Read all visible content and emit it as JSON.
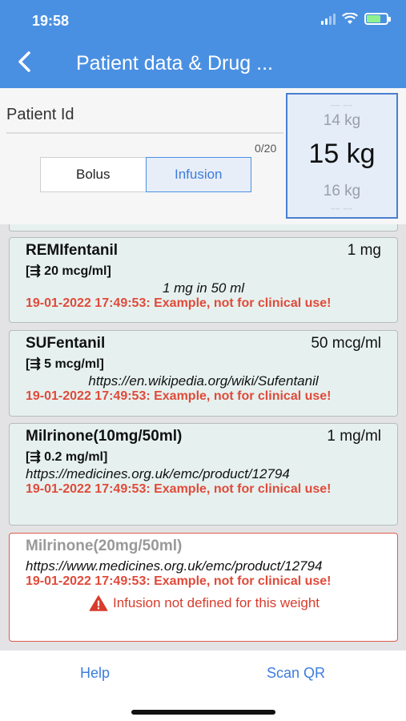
{
  "status_bar": {
    "time": "19:58"
  },
  "nav": {
    "back_icon": "chevron-left-icon",
    "title": "Patient data & Drug ..."
  },
  "form": {
    "patient_id_label": "Patient Id",
    "patient_id_value": "",
    "counter": "0/20",
    "mode_options": [
      "Bolus",
      "Infusion"
    ],
    "mode_selected": "Infusion"
  },
  "weight_picker": {
    "above": "14 kg",
    "selected": "15 kg",
    "below": "16 kg"
  },
  "drugs": [
    {
      "name": "REMIfentanil",
      "dose": "1 mg",
      "concentration": "[⇶ 20 mcg/ml]",
      "info": "1 mg in 50 ml",
      "warning": "19-01-2022 17:49:53: Example, not for clinical use!"
    },
    {
      "name": "SUFentanil",
      "dose": "50 mcg/ml",
      "concentration": "[⇶ 5 mcg/ml]",
      "info": "https://en.wikipedia.org/wiki/Sufentanil",
      "warning": "19-01-2022 17:49:53: Example, not for clinical use!"
    },
    {
      "name": "Milrinone(10mg/50ml)",
      "dose": "1 mg/ml",
      "concentration": "[⇶ 0.2 mg/ml]",
      "info": "https://medicines.org.uk/emc/product/12794",
      "warning": "19-01-2022 17:49:53: Example, not for clinical use!"
    },
    {
      "name": "Milrinone(20mg/50ml)",
      "info": "https://www.medicines.org.uk/emc/product/12794",
      "warning": "19-01-2022 17:49:53: Example, not for clinical use!",
      "error": "Infusion not defined for this weight",
      "error_icon": "warning-triangle-icon"
    }
  ],
  "bottom_bar": {
    "help": "Help",
    "scan_qr": "Scan QR"
  }
}
